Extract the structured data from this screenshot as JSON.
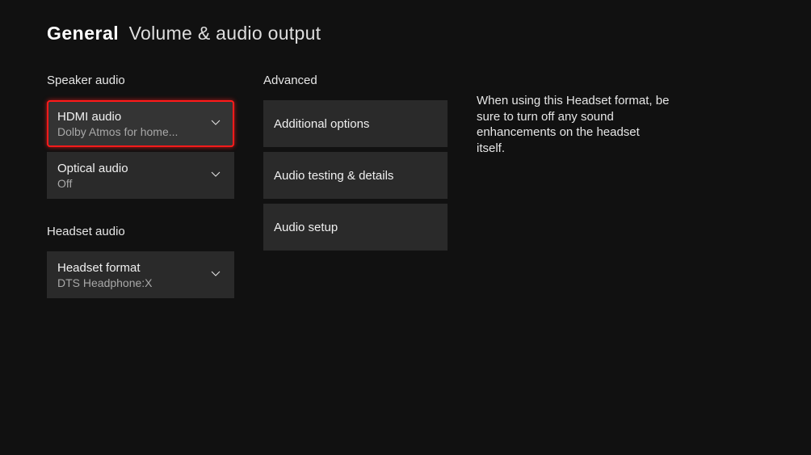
{
  "header": {
    "category": "General",
    "page": "Volume & audio output"
  },
  "speaker": {
    "heading": "Speaker audio",
    "hdmi": {
      "label": "HDMI audio",
      "value": "Dolby Atmos for home..."
    },
    "optical": {
      "label": "Optical audio",
      "value": "Off"
    }
  },
  "headset": {
    "heading": "Headset audio",
    "format": {
      "label": "Headset format",
      "value": "DTS Headphone:X"
    }
  },
  "advanced": {
    "heading": "Advanced",
    "options": "Additional options",
    "testing": "Audio testing & details",
    "setup": "Audio setup"
  },
  "help": {
    "text": "When using this Headset format, be sure to turn off any sound enhancements on the headset itself."
  }
}
